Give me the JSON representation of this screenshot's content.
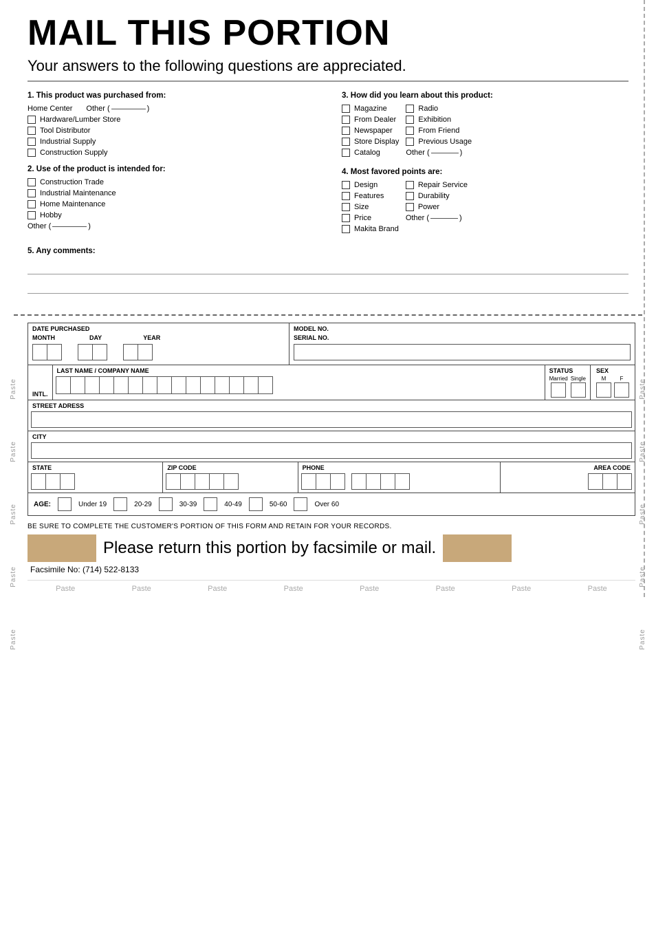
{
  "page": {
    "title": "MAIL THIS PORTION",
    "subtitle": "Your answers to the following questions are appreciated.",
    "right_border_label": "Paste",
    "left_border_label": "Paste"
  },
  "questions": {
    "q1": {
      "title": "1. This product was purchased from:",
      "options": [
        {
          "label": "Home Center"
        },
        {
          "label": "Hardware/Lumber Store"
        },
        {
          "label": "Tool Distributor"
        },
        {
          "label": "Industrial Supply"
        },
        {
          "label": "Construction Supply"
        }
      ],
      "other_label": "Other (",
      "other_close": ")"
    },
    "q2": {
      "title": "2. Use of the product is intended for:",
      "options": [
        {
          "label": "Construction Trade"
        },
        {
          "label": "Industrial Maintenance"
        },
        {
          "label": "Home Maintenance"
        },
        {
          "label": "Hobby"
        },
        {
          "label": "Other (",
          "close": ")"
        }
      ]
    },
    "q3": {
      "title": "3. How did you learn about this product:",
      "col1": [
        "Magazine",
        "From Dealer",
        "Newspaper",
        "Store Display",
        "Catalog"
      ],
      "col2": [
        "Radio",
        "Exhibition",
        "From Friend",
        "Previous Usage"
      ],
      "other_label": "Other (",
      "other_close": ")"
    },
    "q4": {
      "title": "4. Most favored points are:",
      "col1": [
        "Design",
        "Features",
        "Size",
        "Price",
        "Makita Brand"
      ],
      "col2": [
        "Repair Service",
        "Durability",
        "Power"
      ],
      "other_label": "Other (",
      "other_close": ")"
    },
    "q5": {
      "title": "5. Any comments:"
    }
  },
  "form": {
    "date_label": "DATE PURCHASED",
    "month_label": "MONTH",
    "day_label": "DAY",
    "year_label": "YEAR",
    "model_label": "MODEL NO.",
    "serial_label": "SERIAL NO.",
    "intl_label": "INTL.",
    "name_label": "LAST NAME / COMPANY NAME",
    "status_label": "STATUS",
    "married_label": "Married",
    "single_label": "Single",
    "sex_label": "SEX",
    "m_label": "M",
    "f_label": "F",
    "street_label": "STREET ADRESS",
    "city_label": "CITY",
    "state_label": "STATE",
    "zip_label": "ZIP CODE",
    "phone_label": "PHONE",
    "area_code_label": "AREA CODE",
    "age_label": "AGE:",
    "age_options": [
      "Under 19",
      "20-29",
      "30-39",
      "40-49",
      "50-60",
      "Over 60"
    ]
  },
  "bottom": {
    "notice": "BE SURE TO COMPLETE THE CUSTOMER'S PORTION OF THIS FORM AND RETAIN FOR YOUR RECORDS.",
    "return_text": "Please return this portion by facsimile or mail.",
    "fax_text": "Facsimile No: (714) 522-8133",
    "paste_items": [
      "Paste",
      "Paste",
      "Paste",
      "Paste",
      "Paste",
      "Paste",
      "Paste",
      "Paste"
    ]
  },
  "paste_side_labels": {
    "left": [
      "Paste",
      "Paste",
      "Paste",
      "Paste",
      "Paste"
    ],
    "right": [
      "Paste",
      "Paste",
      "Paste",
      "Paste",
      "Paste"
    ]
  }
}
